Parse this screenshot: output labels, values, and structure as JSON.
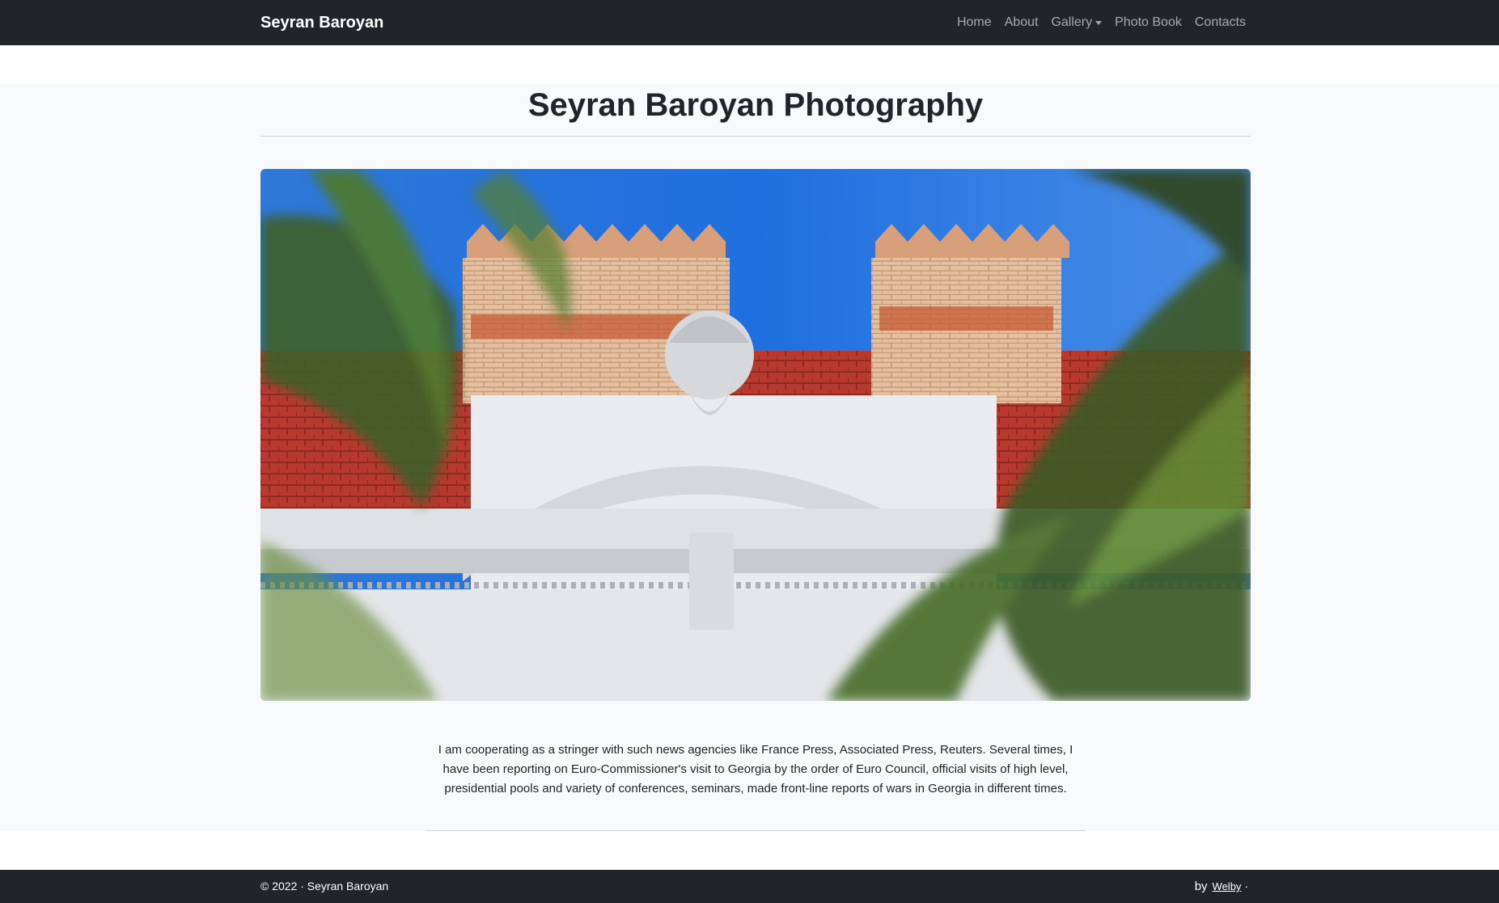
{
  "header": {
    "brand": "Seyran Baroyan",
    "nav": [
      {
        "label": "Home"
      },
      {
        "label": "About"
      },
      {
        "label": "Gallery"
      },
      {
        "label": "Photo Book"
      },
      {
        "label": "Contacts"
      }
    ]
  },
  "main": {
    "title": "Seyran Baroyan Photography",
    "hero_image": "photo of a classical building facade with a bearded sculpted bust, red tiled roof and brick chimneys under a blue sky, framed by blurred palm leaves",
    "about_text": "I am cooperating as a stringer with such news agencies like France Press, Associated Press, Reuters. Several times, I have been reporting on Euro-Commissioner's visit to Georgia by the order of Euro Council, official visits of high level, presidential pools and variety of conferences, seminars, made front-line reports of wars in Georgia in different times."
  },
  "footer": {
    "copyright": "© 2022 · Seyran Baroyan",
    "by": "by",
    "credit_link": "Welby",
    "separator": "·"
  },
  "colors": {
    "navbar_bg": "#212529",
    "main_bg": "#f8f9fa",
    "text": "#212529"
  }
}
